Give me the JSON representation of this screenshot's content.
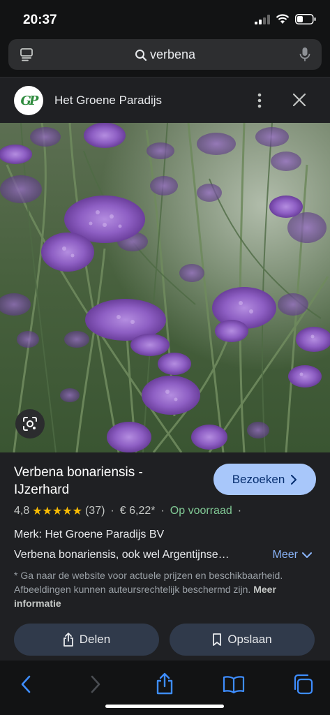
{
  "status_bar": {
    "time": "20:37"
  },
  "search": {
    "query": "verbena"
  },
  "site": {
    "logo_text": "GP",
    "name": "Het Groene Paradijs"
  },
  "product": {
    "title": "Verbena bonariensis - IJzerhard",
    "visit_label": "Bezoeken",
    "rating": "4,8",
    "stars": "★★★★★",
    "review_count": "(37)",
    "price": "€ 6,22*",
    "stock": "Op voorraad",
    "dot": "·",
    "brand": "Merk: Het Groene Paradijs BV",
    "description": "Verbena bonariensis, ook wel Argentijnse…",
    "more_label": "Meer",
    "disclaimer": "* Ga naar de website voor actuele prijzen en beschikbaarheid. Afbeeldingen kunnen auteursrechtelijk beschermd zijn.",
    "more_info_label": "Meer informatie",
    "share_label": "Delen",
    "save_label": "Opslaan"
  },
  "colors": {
    "accent": "#a8c7fa",
    "stock_green": "#81c995",
    "link_blue": "#8ab4f8",
    "star_yellow": "#fbbc04",
    "safari_blue": "#3e8dff"
  },
  "icons": {
    "tabs": "tabs-icon",
    "search": "search-icon",
    "mic": "mic-icon",
    "kebab": "kebab-icon",
    "close": "close-icon",
    "lens": "lens-icon",
    "share": "share-icon",
    "bookmark": "bookmark-icon",
    "back": "back-icon",
    "forward": "forward-icon",
    "book": "bookmarks-icon",
    "tab_switch": "tab-switcher-icon"
  }
}
